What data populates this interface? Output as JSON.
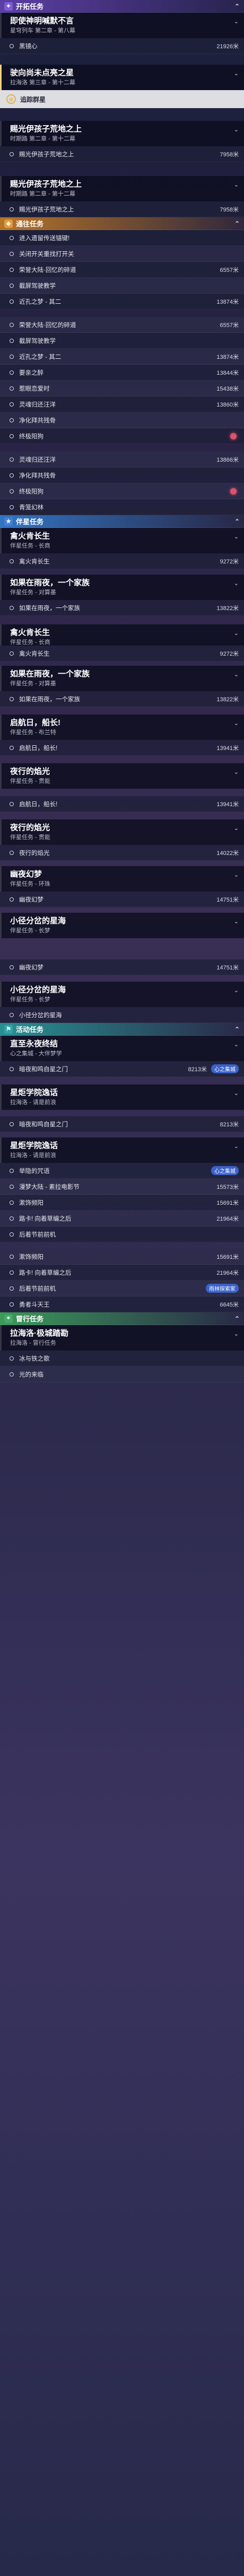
{
  "sections": [
    {
      "key": "trailblaze",
      "label": "开拓任务",
      "icon": "trailblaze-icon",
      "color": "purple",
      "entries": [
        {
          "t": "quest",
          "title": "即使神明喊默不言",
          "sub": "星穹列车 第二章 - 第八幕",
          "h": 48,
          "active": false
        },
        {
          "t": "obj",
          "text": "黑镜心",
          "dist": "21926米",
          "h": 30
        },
        {
          "t": "gap",
          "h": 20
        },
        {
          "t": "quest",
          "title": "驶向尚未点亮之星",
          "sub": "拉海洛 第三章 - 第十二幕",
          "h": 48,
          "active": true
        },
        {
          "t": "track",
          "label": "追踪群星",
          "h": 34
        },
        {
          "t": "gap",
          "h": 24
        },
        {
          "t": "quest",
          "title": "赐光伊孩子荒地之上",
          "sub": "时期路 第二章 - 第十二幕",
          "h": 48,
          "active": false
        },
        {
          "t": "obj",
          "text": "赐光伊孩子荒地之上",
          "dist": "7958米",
          "h": 30
        },
        {
          "t": "gap",
          "h": 26
        },
        {
          "t": "quest",
          "title": "赐光伊孩子荒地之上",
          "sub": "时期路 第二章 - 第十二幕",
          "h": 48,
          "active": false
        },
        {
          "t": "obj",
          "text": "赐光伊孩子荒地之上",
          "dist": "7958米",
          "h": 30
        }
      ]
    },
    {
      "key": "daily",
      "label": "通往任务",
      "icon": "compass-icon",
      "color": "orange",
      "entries": [
        {
          "t": "obj",
          "text": "进入遗留传送锚键!",
          "dist": "",
          "h": 30
        },
        {
          "t": "obj",
          "text": "关闭开关重找打开关",
          "dist": "",
          "h": 30
        },
        {
          "t": "obj",
          "text": "荣誉大陆·回忆的碎道",
          "dist": "6557米",
          "h": 30
        },
        {
          "t": "obj",
          "text": "截屏驾驶教学",
          "dist": "",
          "h": 30
        },
        {
          "t": "obj",
          "text": "近孔之梦 - 其二",
          "dist": "13874米",
          "h": 30
        },
        {
          "t": "gap",
          "h": 14
        },
        {
          "t": "obj",
          "text": "荣誉大陆·回忆的碎道",
          "dist": "6557米",
          "h": 30
        },
        {
          "t": "obj",
          "text": "截屏驾驶教学",
          "dist": "",
          "h": 30
        },
        {
          "t": "obj",
          "text": "近孔之梦 - 其二",
          "dist": "13874米",
          "h": 30
        },
        {
          "t": "obj",
          "text": "要亲之醉",
          "dist": "13844米",
          "h": 30
        },
        {
          "t": "obj",
          "text": "惹眼恋爱时",
          "dist": "15438米",
          "h": 30
        },
        {
          "t": "obj",
          "text": "灵魂归还汪洋",
          "dist": "13860米",
          "h": 30
        },
        {
          "t": "obj",
          "text": "净化拜共残骨",
          "dist": "",
          "h": 30
        },
        {
          "t": "obj",
          "text": "终极阳狗",
          "dist": "",
          "h": 30,
          "mark": true
        },
        {
          "t": "gap",
          "h": 14
        },
        {
          "t": "obj",
          "text": "灵魂归还汪洋",
          "dist": "13866米",
          "h": 30
        },
        {
          "t": "obj",
          "text": "净化拜共残骨",
          "dist": "",
          "h": 30
        },
        {
          "t": "obj",
          "text": "终极阳狗",
          "dist": "",
          "h": 30,
          "mark": true
        },
        {
          "t": "obj",
          "text": "青笼幻林",
          "dist": "",
          "h": 30
        }
      ]
    },
    {
      "key": "companion",
      "label": "伴星任务",
      "icon": "star-icon",
      "color": "blue",
      "entries": [
        {
          "t": "quest",
          "title": "禽火肯长生",
          "sub": "伴星任务 - 长商",
          "h": 48,
          "active": false
        },
        {
          "t": "obj",
          "text": "禽火肯长生",
          "dist": "9272米",
          "h": 30
        },
        {
          "t": "gap",
          "h": 10
        },
        {
          "t": "quest",
          "title": "如果在雨夜，一个家族",
          "sub": "伴星任务 - 对算墨",
          "h": 48,
          "active": false
        },
        {
          "t": "obj",
          "text": "如果在雨夜，一个家族",
          "dist": "13822米",
          "h": 30
        },
        {
          "t": "gap",
          "h": 16
        },
        {
          "t": "quest",
          "title": "禽火肯长生",
          "sub": "伴星任务 - 长商",
          "h": 40,
          "active": false
        },
        {
          "t": "obj",
          "text": "禽火肯长生",
          "dist": "9272米",
          "h": 30
        },
        {
          "t": "gap",
          "h": 8
        },
        {
          "t": "quest",
          "title": "如果在雨夜，一个家族",
          "sub": "伴星任务 - 对算墨",
          "h": 48,
          "active": false
        },
        {
          "t": "obj",
          "text": "如果在雨夜，一个家族",
          "dist": "13822米",
          "h": 30
        },
        {
          "t": "gap",
          "h": 14
        },
        {
          "t": "quest",
          "title": "启航日，船长!",
          "sub": "伴星任务 - 布兰特",
          "h": 48,
          "active": false
        },
        {
          "t": "obj",
          "text": "启航日，船长!",
          "dist": "13941米",
          "h": 30
        },
        {
          "t": "gap",
          "h": 14
        },
        {
          "t": "quest",
          "title": "夜行的焰光",
          "sub": "伴星任务 - 贯能",
          "h": 48,
          "active": false
        },
        {
          "t": "gap",
          "h": 14
        },
        {
          "t": "obj",
          "text": "启航日，船长!",
          "dist": "13941米",
          "h": 30
        },
        {
          "t": "gap",
          "h": 14
        },
        {
          "t": "quest",
          "title": "夜行的焰光",
          "sub": "伴星任务 - 贯能",
          "h": 48,
          "active": false
        },
        {
          "t": "obj",
          "text": "夜行的焰光",
          "dist": "14022米",
          "h": 30
        },
        {
          "t": "gap",
          "h": 10
        },
        {
          "t": "quest",
          "title": "幽夜幻梦",
          "sub": "伴星任务 - 环珠",
          "h": 48,
          "active": false
        },
        {
          "t": "obj",
          "text": "幽夜幻梦",
          "dist": "14751米",
          "h": 30
        },
        {
          "t": "gap",
          "h": 10
        },
        {
          "t": "quest",
          "title": "小径分岔的星海",
          "sub": "伴星任务 - 长梦",
          "h": 48,
          "active": false
        },
        {
          "t": "gap",
          "h": 40
        },
        {
          "t": "obj",
          "text": "幽夜幻梦",
          "dist": "14751米",
          "h": 30
        },
        {
          "t": "gap",
          "h": 12
        },
        {
          "t": "quest",
          "title": "小径分岔的星海",
          "sub": "伴星任务 - 长梦",
          "h": 48,
          "active": false
        },
        {
          "t": "obj",
          "text": "小径分岔的星海",
          "dist": "",
          "h": 30
        }
      ]
    },
    {
      "key": "event",
      "label": "活动任务",
      "icon": "flag-icon",
      "color": "teal",
      "entries": [
        {
          "t": "quest",
          "title": "直至永夜终结",
          "sub": "心之集城 - 大伴梦学",
          "h": 48,
          "active": false
        },
        {
          "t": "obj",
          "text": "暗夜和鸣自星之门",
          "dist": "8213米",
          "h": 30,
          "tag": "心之集城"
        },
        {
          "t": "gap",
          "h": 14
        },
        {
          "t": "quest",
          "title": "星炬学院逸话",
          "sub": "拉海洛 - 请是前浪",
          "h": 48,
          "active": false
        },
        {
          "t": "gap",
          "h": 12
        },
        {
          "t": "obj",
          "text": "暗夜和鸣自星之门",
          "dist": "8213米",
          "h": 30
        },
        {
          "t": "gap",
          "h": 10
        },
        {
          "t": "quest",
          "title": "星炬学院逸话",
          "sub": "拉海洛 - 请是前浪",
          "h": 48,
          "active": false
        },
        {
          "t": "obj",
          "text": "举隐的咒语",
          "dist": "",
          "h": 30,
          "tag": "心之集城"
        },
        {
          "t": "obj",
          "text": "漫梦大陆 - 素拉电影节",
          "dist": "15573米",
          "h": 30
        },
        {
          "t": "obj",
          "text": "漱饰频阳",
          "dist": "15691米",
          "h": 30
        },
        {
          "t": "obj",
          "text": "路卡! 向着草编之后",
          "dist": "21964米",
          "h": 30
        },
        {
          "t": "obj",
          "text": "后着节前前机",
          "dist": "",
          "h": 30
        },
        {
          "t": "gap",
          "h": 12
        },
        {
          "t": "obj",
          "text": "漱饰频阳",
          "dist": "15691米",
          "h": 30
        },
        {
          "t": "obj",
          "text": "路卡! 向着草编之后",
          "dist": "21964米",
          "h": 30
        },
        {
          "t": "obj",
          "text": "后着节前前机",
          "dist": "",
          "h": 30,
          "tag": "雨林探索家"
        },
        {
          "t": "obj",
          "text": "勇者斗天王",
          "dist": "6645米",
          "h": 30
        }
      ]
    },
    {
      "key": "adventure",
      "label": "冒行任务",
      "icon": "map-icon",
      "color": "green",
      "entries": [
        {
          "t": "quest",
          "title": "拉海洛·极城踏勘",
          "sub": "拉海洛 - 冒行任务",
          "h": 48,
          "active": false
        },
        {
          "t": "obj",
          "text": "冰与铁之歌",
          "dist": "",
          "h": 30
        },
        {
          "t": "obj",
          "text": "光的来临",
          "dist": "",
          "h": 30
        }
      ]
    }
  ]
}
